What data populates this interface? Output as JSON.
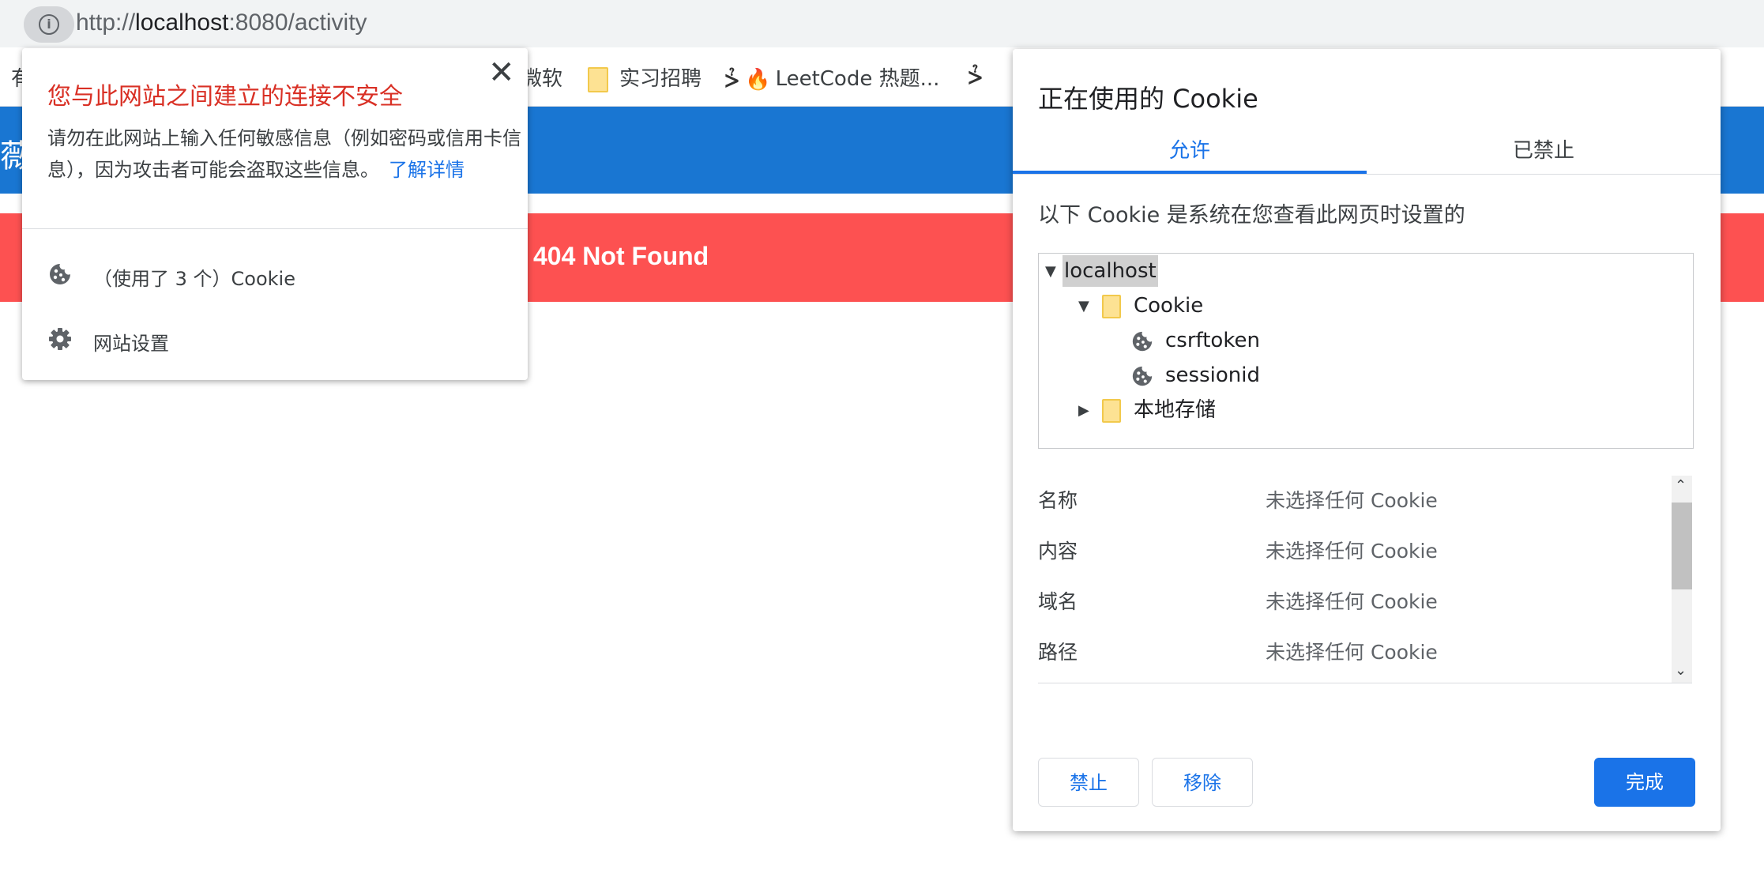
{
  "browser": {
    "url_scheme": "http://",
    "url_host": "localhost",
    "url_rest": ":8080/activity",
    "bookmarks": [
      {
        "label": "有"
      },
      {
        "label": "微软"
      },
      {
        "label": "实习招聘",
        "icon": "folder-icon"
      },
      {
        "label": "LeetCode 热题...",
        "icon": "leetcode-icon"
      }
    ]
  },
  "page": {
    "header_text": "薇",
    "error_text": "404 Not Found",
    "colors": {
      "header": "#1976d2",
      "error": "#fd5151"
    }
  },
  "site_info": {
    "title": "您与此网站之间建立的连接不安全",
    "description": "请勿在此网站上输入任何敏感信息（例如密码或信用卡信息），因为攻击者可能会盗取这些信息。",
    "learn_more": "了解详情",
    "cookies_label": "（使用了 3 个）Cookie",
    "site_settings_label": "网站设置",
    "close_icon": "✕"
  },
  "cookie_dialog": {
    "title": "正在使用的 Cookie",
    "tabs": {
      "allowed": "允许",
      "blocked": "已禁止"
    },
    "subtitle": "以下 Cookie 是系统在您查看此网页时设置的",
    "tree": {
      "root": "localhost",
      "folder_cookie": "Cookie",
      "cookies": [
        "csrftoken",
        "sessionid"
      ],
      "local_storage": "本地存储"
    },
    "details": [
      {
        "key": "名称",
        "value": "未选择任何 Cookie"
      },
      {
        "key": "内容",
        "value": "未选择任何 Cookie"
      },
      {
        "key": "域名",
        "value": "未选择任何 Cookie"
      },
      {
        "key": "路径",
        "value": "未选择任何 Cookie"
      }
    ],
    "buttons": {
      "block": "禁止",
      "remove": "移除",
      "done": "完成"
    }
  }
}
